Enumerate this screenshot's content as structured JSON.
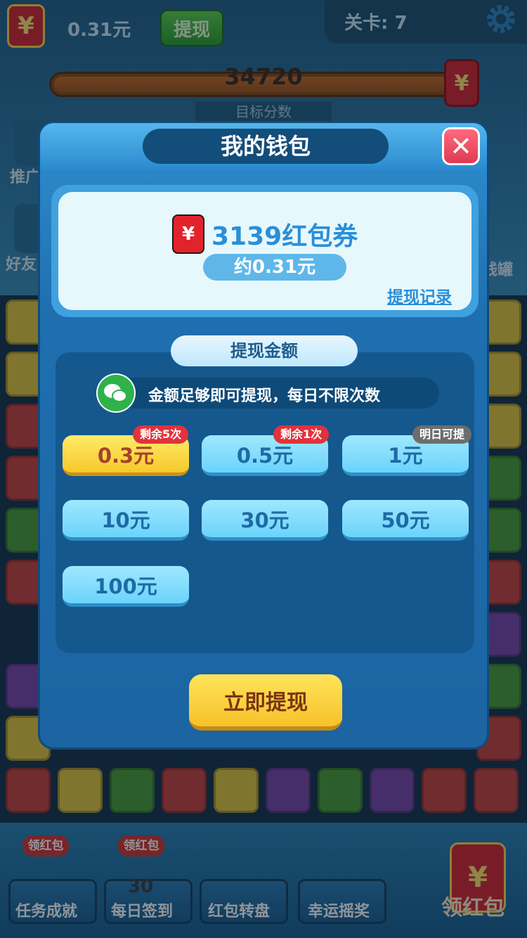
{
  "topbar": {
    "currency_symbol": "¥",
    "cash_value": "0.31元",
    "withdraw_label": "提现",
    "level_text": "关卡: 7"
  },
  "score": {
    "value": "34720",
    "target_label": "目标分数"
  },
  "side": {
    "promo_label": "推广",
    "friends_label": "好友",
    "piggy_label": "钱罐"
  },
  "bottom_nav": {
    "tag": "领红包",
    "items": [
      {
        "label": "任务成就"
      },
      {
        "label": "每日签到",
        "calendar_day": "30"
      },
      {
        "label": "红包转盘"
      },
      {
        "label": "幸运摇奖"
      }
    ],
    "big_red_label": "领红包"
  },
  "wallet": {
    "title": "我的钱包",
    "close_symbol": "✕",
    "coupon_icon": "¥",
    "coupons": "3139红包券",
    "approx": "约0.31元",
    "record_link": "提现记录",
    "amount_title": "提现金额",
    "wechat_text": "金额足够即可提现，每日不限次数",
    "amounts": [
      {
        "label": "0.3元",
        "badge": "剩余5次",
        "selected": true
      },
      {
        "label": "0.5元",
        "badge": "剩余1次"
      },
      {
        "label": "1元",
        "badge": "明日可提"
      },
      {
        "label": "10元"
      },
      {
        "label": "30元"
      },
      {
        "label": "50元"
      },
      {
        "label": "100元"
      }
    ],
    "withdraw_button": "立即提现"
  },
  "colors": {
    "modal_blue": "#1f6fb0",
    "accent_yellow": "#f6c82a",
    "badge_red": "#e0333b",
    "wechat_green": "#2fb24a"
  }
}
